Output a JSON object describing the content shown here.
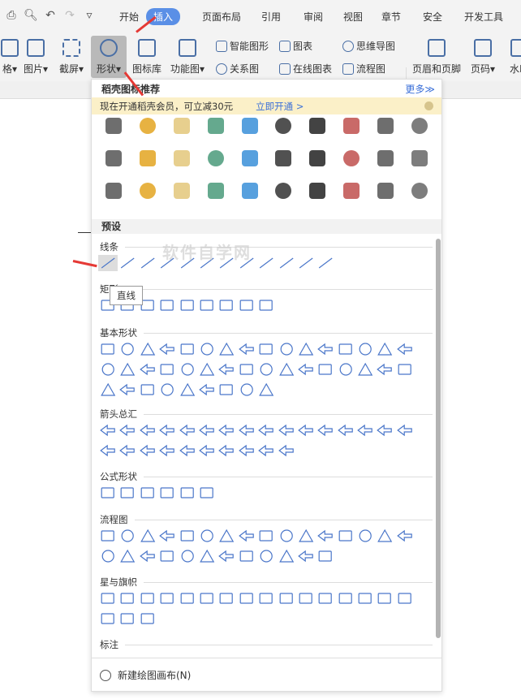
{
  "menu_tabs": [
    "开始",
    "插入",
    "页面布局",
    "引用",
    "审阅",
    "视图",
    "章节",
    "安全",
    "开发工具"
  ],
  "active_tab": "插入",
  "ribbon": {
    "big": [
      {
        "label": "格",
        "x": 0
      },
      {
        "label": "图片"
      },
      {
        "label": "截屏"
      },
      {
        "label": "形状"
      },
      {
        "label": "图标库"
      },
      {
        "label": "功能图"
      }
    ],
    "small": [
      "智能图形",
      "关系图",
      "图表",
      "在线图表",
      "思维导图",
      "流程图"
    ],
    "right": [
      "页眉和页脚",
      "页码",
      "水印"
    ]
  },
  "panel": {
    "title": "稻壳图标推荐",
    "more": "更多≫",
    "banner_text": "现在开通稻壳会员，可立减30元",
    "banner_link": "立即开通 >",
    "preset": "预设",
    "sections": [
      "线条",
      "矩形",
      "基本形状",
      "箭头总汇",
      "公式形状",
      "流程图",
      "星与旗帜",
      "标注"
    ],
    "tooltip": "直线",
    "new_canvas": "新建绘图画布(N)",
    "watermark": "软件自学网"
  },
  "colors": {
    "accent": "#5a8fe6",
    "shape_stroke": "#4a76c9",
    "banner": "#fbf0c8"
  }
}
